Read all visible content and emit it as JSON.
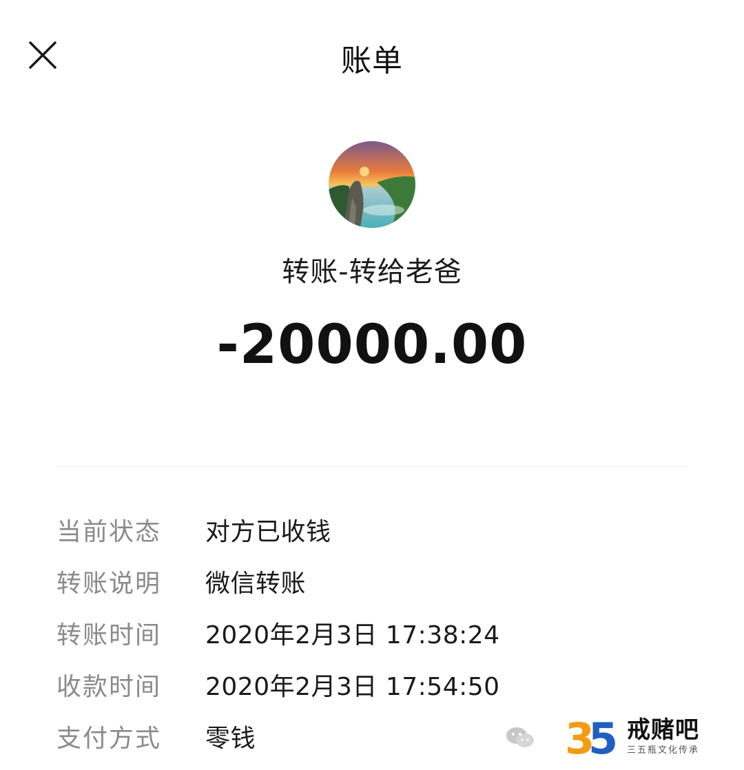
{
  "header": {
    "title": "账单",
    "close_icon": "close-icon"
  },
  "transaction": {
    "avatar_icon": "avatar-landscape-photo",
    "title": "转账-转给老爸",
    "amount": "-20000.00"
  },
  "details": [
    {
      "label": "当前状态",
      "value": "对方已收钱"
    },
    {
      "label": "转账说明",
      "value": "微信转账"
    },
    {
      "label": "转账时间",
      "value": "2020年2月3日 17:38:24"
    },
    {
      "label": "收款时间",
      "value": "2020年2月3日 17:54:50"
    },
    {
      "label": "支付方式",
      "value": "零钱"
    }
  ],
  "watermark": {
    "logo_text": "35",
    "name": "戒赌吧",
    "tagline": "三五瓶文化传承"
  },
  "colors": {
    "text_primary": "#1a1a1a",
    "text_label": "#8a8a8a",
    "divider": "#ececec",
    "logo_orange": "#f39c12",
    "logo_blue": "#1f5fbf"
  }
}
